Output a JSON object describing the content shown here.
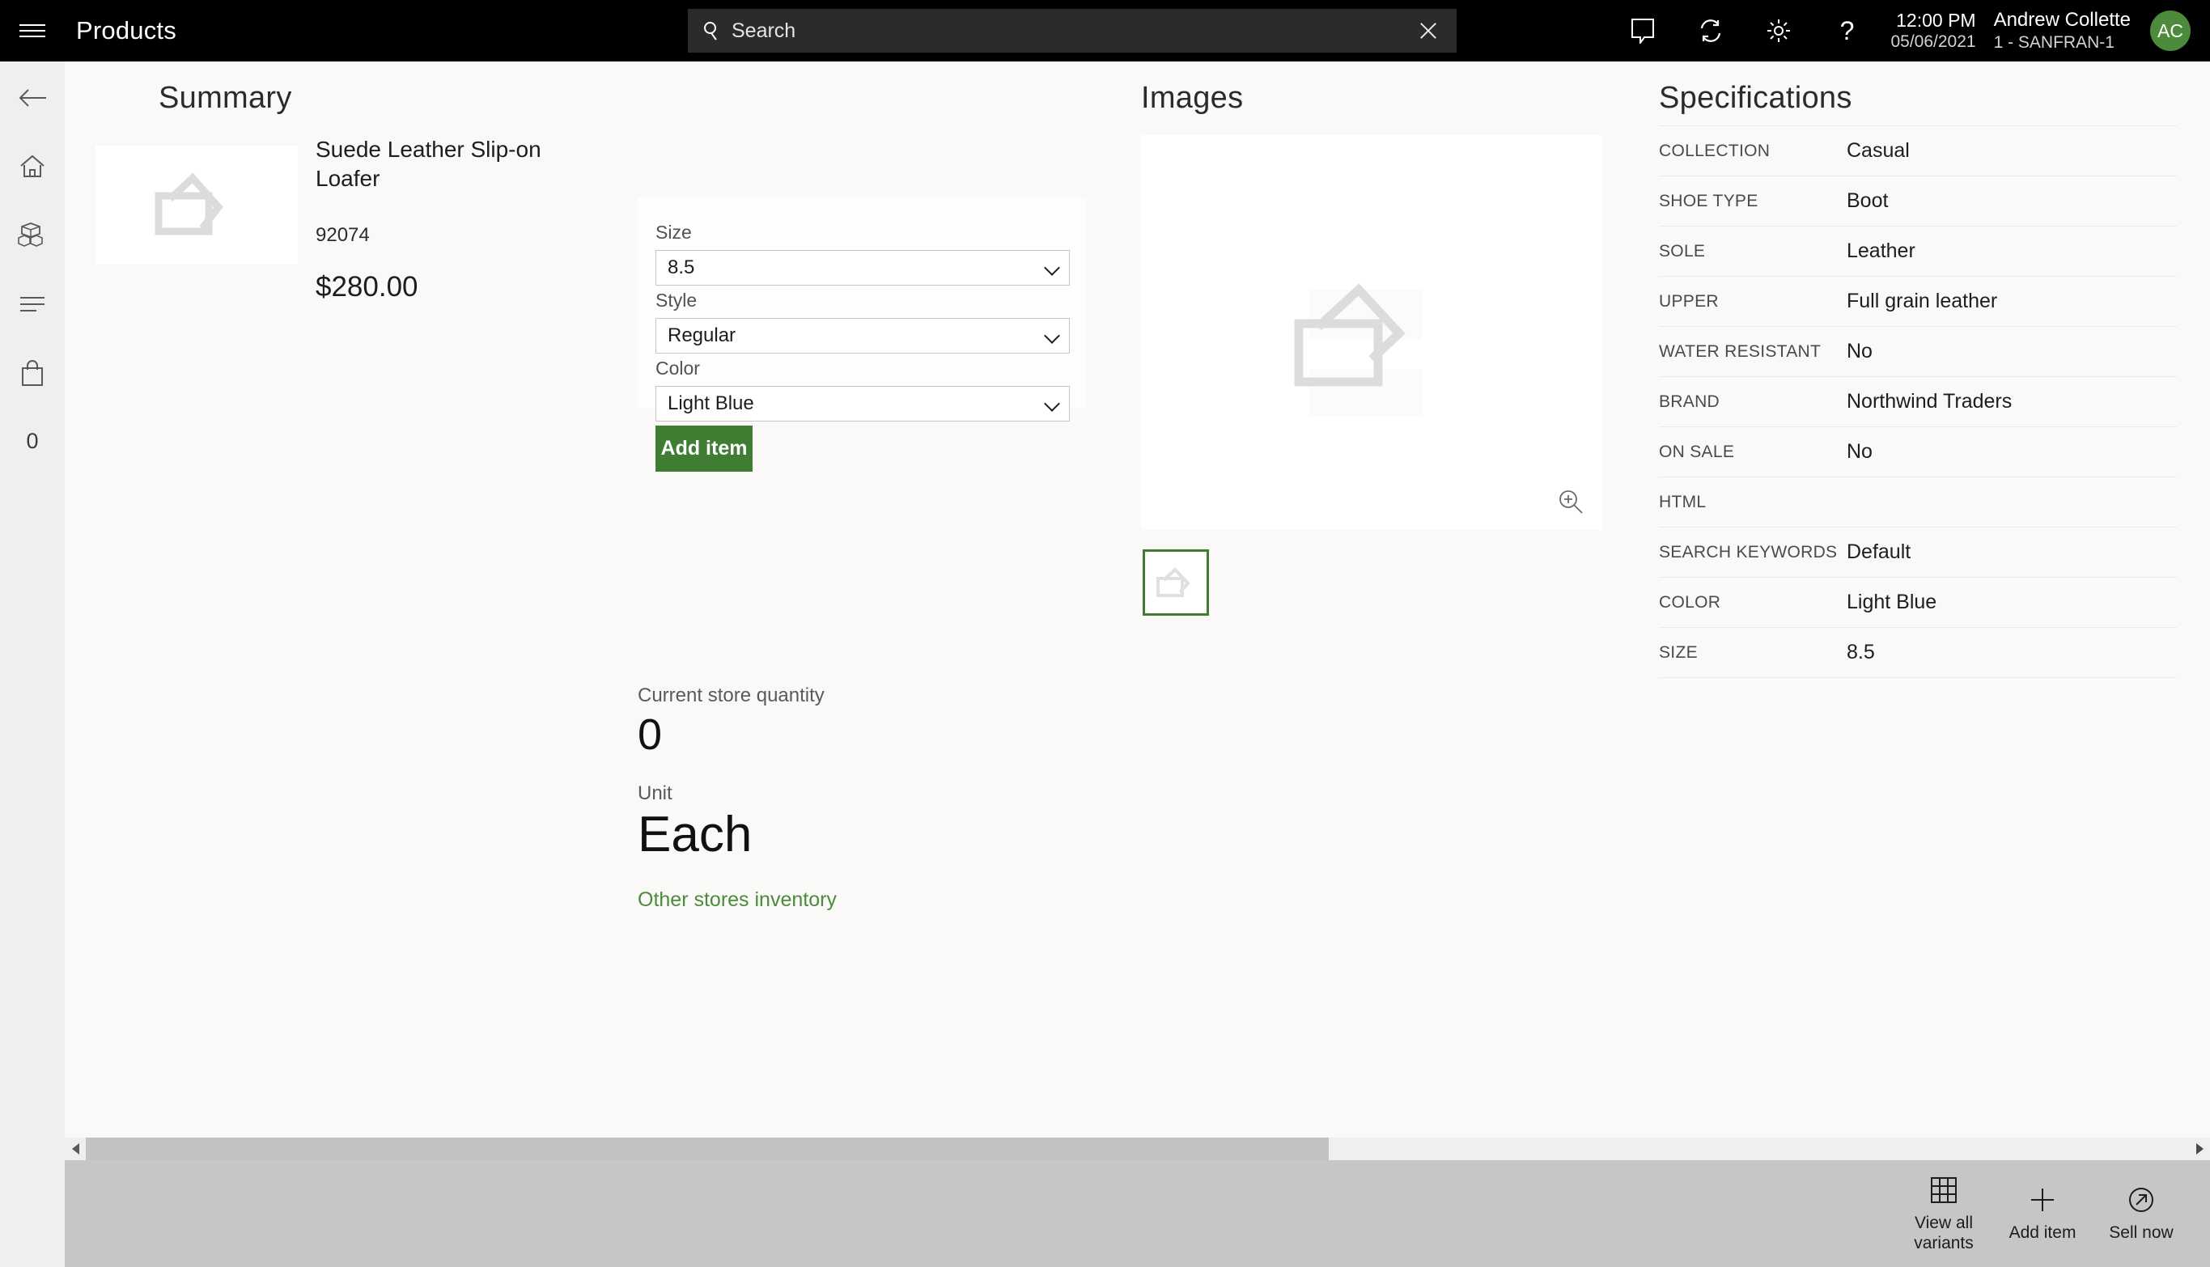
{
  "topbar": {
    "menu_icon": "hamburger-icon",
    "title": "Products",
    "search": {
      "placeholder": "Search",
      "value": "",
      "icon": "search-icon",
      "clear_icon": "close-icon"
    },
    "icons": [
      "comment-icon",
      "sync-icon",
      "gear-icon",
      "help-icon"
    ],
    "time": "12:00 PM",
    "date": "05/06/2021",
    "user_name": "Andrew Collette",
    "user_store": "1 - SANFRAN-1",
    "avatar_initials": "AC",
    "avatar_color": "#4b8b3b"
  },
  "leftnav": {
    "items": [
      {
        "name": "back-arrow-icon",
        "label": ""
      },
      {
        "name": "home-icon",
        "label": ""
      },
      {
        "name": "products-icon",
        "label": ""
      },
      {
        "name": "list-icon",
        "label": ""
      },
      {
        "name": "shopping-bag-icon",
        "label": ""
      }
    ],
    "cart_count": "0"
  },
  "summary": {
    "title": "Summary",
    "product_name": "Suede Leather Slip-on Loafer",
    "product_number": "92074",
    "price": "$280.00",
    "thumb_icon": "image-placeholder-icon"
  },
  "variant_form": {
    "fields": [
      {
        "label": "Size",
        "value": "8.5",
        "options": [
          "8.5"
        ]
      },
      {
        "label": "Style",
        "value": "Regular",
        "options": [
          "Regular"
        ]
      },
      {
        "label": "Color",
        "value": "Light Blue",
        "options": [
          "Light Blue"
        ]
      }
    ],
    "add_item_label": "Add item"
  },
  "inventory": {
    "quantity_label": "Current store quantity",
    "quantity_value": "0",
    "unit_label": "Unit",
    "unit_value": "Each",
    "other_stores_link": "Other stores inventory",
    "link_color": "#4b8b3b"
  },
  "images": {
    "title": "Images",
    "main_icon": "image-placeholder-icon",
    "zoom_icon": "zoom-in-icon",
    "thumbnails": [
      {
        "icon": "image-placeholder-icon",
        "selected": true
      }
    ],
    "selection_color": "#3e7d32"
  },
  "specifications": {
    "title": "Specifications",
    "rows": [
      {
        "key": "COLLECTION",
        "value": "Casual"
      },
      {
        "key": "SHOE TYPE",
        "value": "Boot"
      },
      {
        "key": "SOLE",
        "value": "Leather"
      },
      {
        "key": "UPPER",
        "value": "Full grain leather"
      },
      {
        "key": "WATER RESISTANT",
        "value": "No"
      },
      {
        "key": "BRAND",
        "value": "Northwind Traders"
      },
      {
        "key": "ON SALE",
        "value": "No"
      },
      {
        "key": "HTML",
        "value": ""
      },
      {
        "key": "SEARCH KEYWORDS",
        "value": "Default"
      },
      {
        "key": "COLOR",
        "value": "Light Blue"
      },
      {
        "key": "SIZE",
        "value": "8.5"
      }
    ]
  },
  "scrollbar": {
    "left_arrow_icon": "chevron-left-icon",
    "right_arrow_icon": "chevron-right-icon"
  },
  "bottombar": {
    "commands": [
      {
        "icon": "grid-icon",
        "label": "View all variants"
      },
      {
        "icon": "plus-icon",
        "label": "Add item"
      },
      {
        "icon": "arrow-circle-icon",
        "label": "Sell now"
      }
    ]
  }
}
